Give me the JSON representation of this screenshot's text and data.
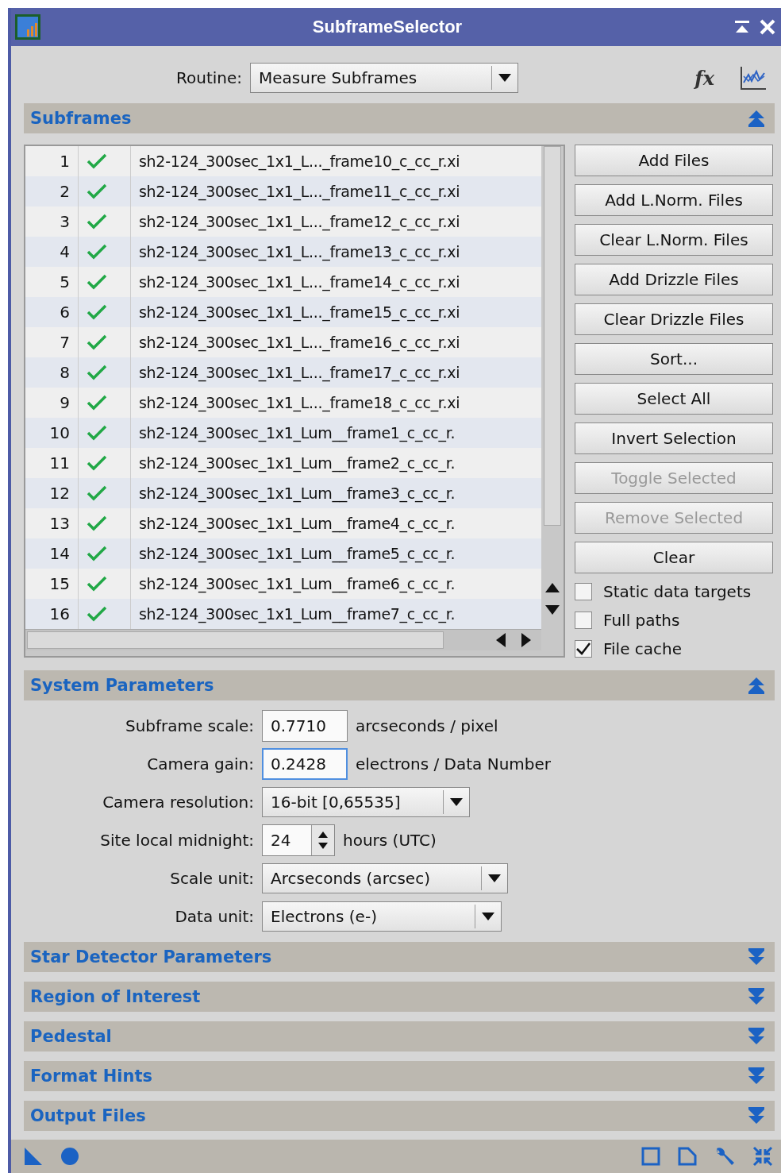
{
  "window": {
    "title": "SubframeSelector"
  },
  "routine": {
    "label": "Routine:",
    "value": "Measure Subframes"
  },
  "expression_button": "fx",
  "subframes": {
    "title": "Subframes",
    "expanded": true,
    "rows": [
      {
        "index": "1",
        "checked": true,
        "file": "sh2-124_300sec_1x1_L..._frame10_c_cc_r.xi"
      },
      {
        "index": "2",
        "checked": true,
        "file": "sh2-124_300sec_1x1_L..._frame11_c_cc_r.xi"
      },
      {
        "index": "3",
        "checked": true,
        "file": "sh2-124_300sec_1x1_L..._frame12_c_cc_r.xi"
      },
      {
        "index": "4",
        "checked": true,
        "file": "sh2-124_300sec_1x1_L..._frame13_c_cc_r.xi"
      },
      {
        "index": "5",
        "checked": true,
        "file": "sh2-124_300sec_1x1_L..._frame14_c_cc_r.xi"
      },
      {
        "index": "6",
        "checked": true,
        "file": "sh2-124_300sec_1x1_L..._frame15_c_cc_r.xi"
      },
      {
        "index": "7",
        "checked": true,
        "file": "sh2-124_300sec_1x1_L..._frame16_c_cc_r.xi"
      },
      {
        "index": "8",
        "checked": true,
        "file": "sh2-124_300sec_1x1_L..._frame17_c_cc_r.xi"
      },
      {
        "index": "9",
        "checked": true,
        "file": "sh2-124_300sec_1x1_L..._frame18_c_cc_r.xi"
      },
      {
        "index": "10",
        "checked": true,
        "file": "sh2-124_300sec_1x1_Lum__frame1_c_cc_r."
      },
      {
        "index": "11",
        "checked": true,
        "file": "sh2-124_300sec_1x1_Lum__frame2_c_cc_r."
      },
      {
        "index": "12",
        "checked": true,
        "file": "sh2-124_300sec_1x1_Lum__frame3_c_cc_r."
      },
      {
        "index": "13",
        "checked": true,
        "file": "sh2-124_300sec_1x1_Lum__frame4_c_cc_r."
      },
      {
        "index": "14",
        "checked": true,
        "file": "sh2-124_300sec_1x1_Lum__frame5_c_cc_r."
      },
      {
        "index": "15",
        "checked": true,
        "file": "sh2-124_300sec_1x1_Lum__frame6_c_cc_r."
      },
      {
        "index": "16",
        "checked": true,
        "file": "sh2-124_300sec_1x1_Lum__frame7_c_cc_r."
      }
    ],
    "buttons": [
      {
        "label": "Add Files",
        "disabled": false
      },
      {
        "label": "Add L.Norm. Files",
        "disabled": false
      },
      {
        "label": "Clear L.Norm. Files",
        "disabled": false
      },
      {
        "label": "Add Drizzle Files",
        "disabled": false
      },
      {
        "label": "Clear Drizzle Files",
        "disabled": false
      },
      {
        "label": "Sort...",
        "disabled": false
      },
      {
        "label": "Select All",
        "disabled": false
      },
      {
        "label": "Invert Selection",
        "disabled": false
      },
      {
        "label": "Toggle Selected",
        "disabled": true
      },
      {
        "label": "Remove Selected",
        "disabled": true
      },
      {
        "label": "Clear",
        "disabled": false
      }
    ],
    "options": [
      {
        "label": "Static data targets",
        "checked": false
      },
      {
        "label": "Full paths",
        "checked": false
      },
      {
        "label": "File cache",
        "checked": true
      }
    ]
  },
  "system_parameters": {
    "title": "System Parameters",
    "expanded": true,
    "fields": [
      {
        "kind": "field",
        "label": "Subframe scale:",
        "value": "0.7710",
        "unit": "arcseconds / pixel",
        "focused": false
      },
      {
        "kind": "field",
        "label": "Camera gain:",
        "value": "0.2428",
        "unit": "electrons / Data Number",
        "focused": true
      },
      {
        "kind": "combo",
        "label": "Camera resolution:",
        "value": "16-bit [0,65535]"
      },
      {
        "kind": "spin",
        "label": "Site local midnight:",
        "value": "24",
        "unit": "hours (UTC)"
      },
      {
        "kind": "combo",
        "label": "Scale unit:",
        "value": "Arcseconds (arcsec)"
      },
      {
        "kind": "combo",
        "label": "Data unit:",
        "value": "Electrons (e-)"
      }
    ]
  },
  "collapsed_sections": [
    {
      "title": "Star Detector Parameters",
      "expanded": false
    },
    {
      "title": "Region of Interest",
      "expanded": false
    },
    {
      "title": "Pedestal",
      "expanded": false
    },
    {
      "title": "Format Hints",
      "expanded": false
    },
    {
      "title": "Output Files",
      "expanded": false
    }
  ]
}
